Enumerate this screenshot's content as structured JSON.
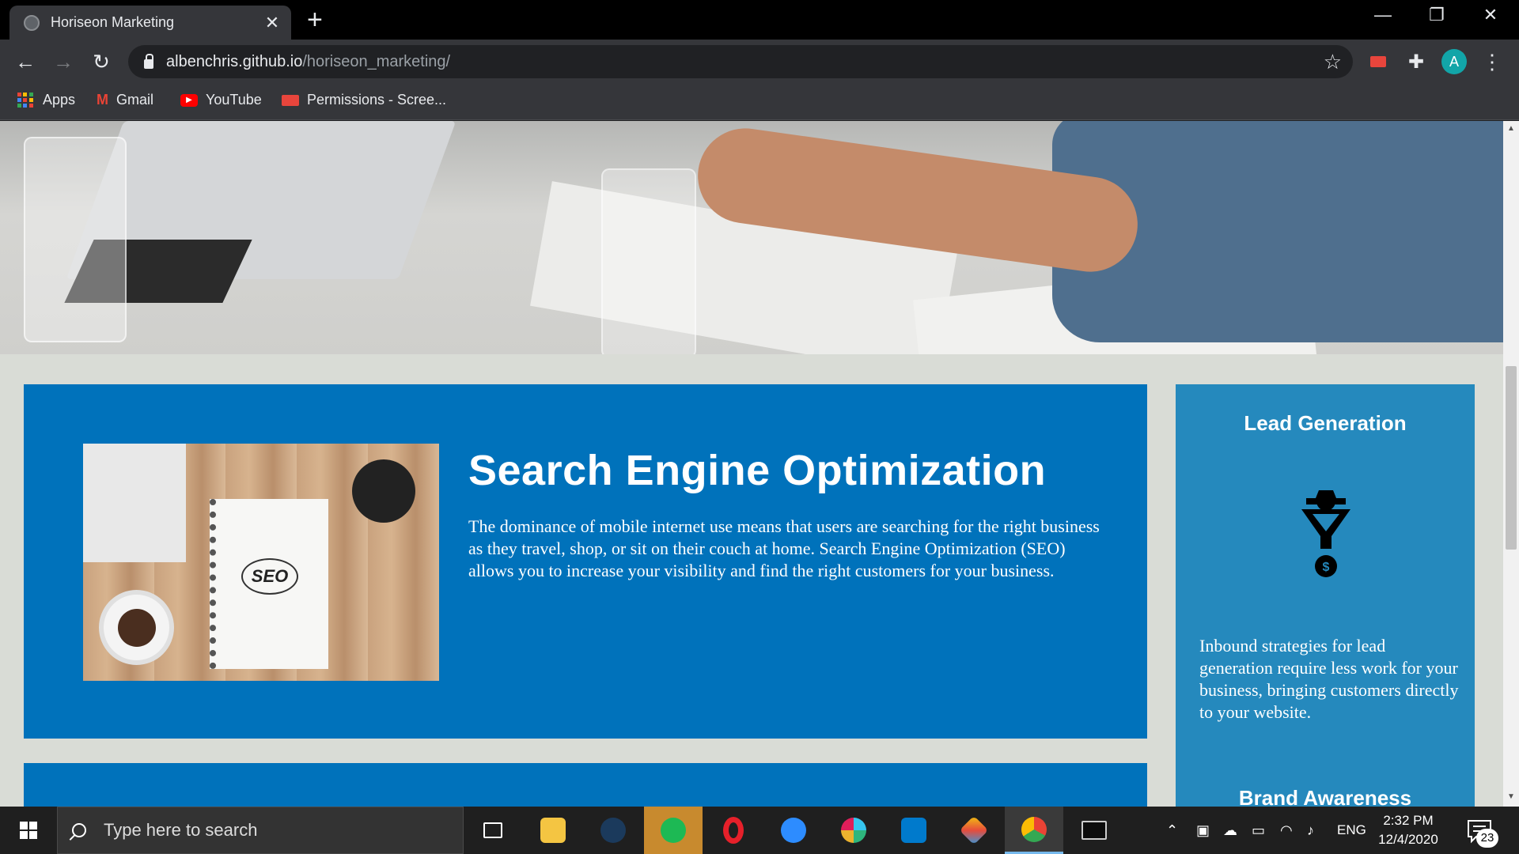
{
  "browser": {
    "tab_title": "Horiseon Marketing",
    "url_host": "albenchris.github.io",
    "url_path": "/horiseon_marketing/",
    "avatar_letter": "A",
    "bookmarks": [
      {
        "label": "Apps"
      },
      {
        "label": "Gmail"
      },
      {
        "label": "YouTube"
      },
      {
        "label": "Permissions - Scree..."
      }
    ]
  },
  "page": {
    "main": {
      "title": "Search Engine Optimization",
      "text": "The dominance of mobile internet use means that users are searching for the right business as they travel, shop, or sit on their couch at home. Search Engine Optimization (SEO) allows you to increase your visibility and find the right customers for your business.",
      "image_label": "SEO"
    },
    "sidebar": {
      "lead_title": "Lead Generation",
      "lead_text": "Inbound strategies for lead generation require less work for your business, bringing customers directly to your website.",
      "brand_title": "Brand Awareness"
    },
    "colors": {
      "card_blue": "#0072bb",
      "sidebar_blue": "#2589bd",
      "page_bg": "#d9dcd6"
    }
  },
  "taskbar": {
    "search_placeholder": "Type here to search",
    "language": "ENG",
    "time": "2:32 PM",
    "date": "12/4/2020",
    "notification_count": "23"
  }
}
